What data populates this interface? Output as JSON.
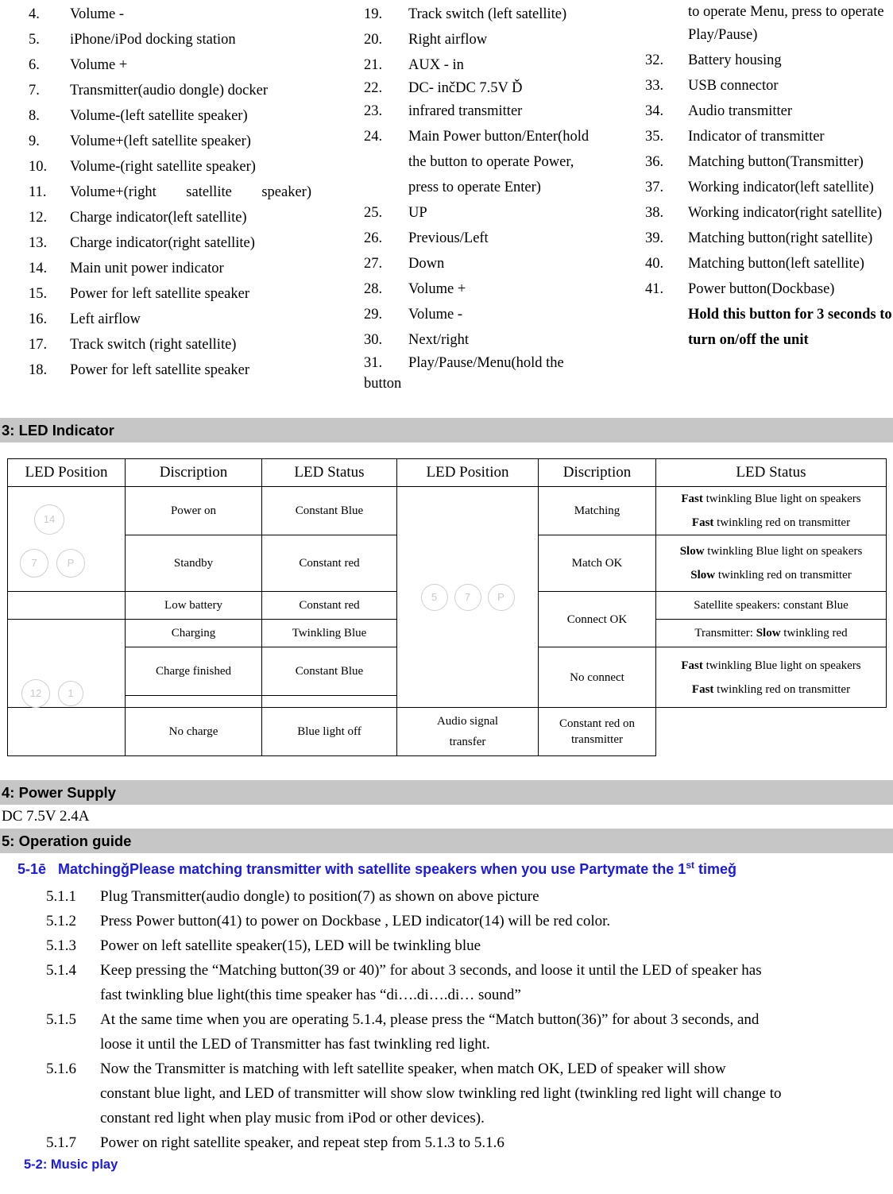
{
  "parts": {
    "left_column": [
      {
        "num": "4.",
        "label": "Volume -"
      },
      {
        "num": "5.",
        "label": "iPhone/iPod docking station"
      },
      {
        "num": "6.",
        "label": "Volume +"
      },
      {
        "num": "7.",
        "label": "Transmitter(audio dongle) docker"
      },
      {
        "num": "8.",
        "label": "Volume-(left satellite speaker)"
      },
      {
        "num": "9.",
        "label": "Volume+(left satellite speaker)"
      },
      {
        "num": "10.",
        "label": "Volume-(right satellite speaker)"
      },
      {
        "num": "11.",
        "label": "Volume+(right satellite speaker)"
      },
      {
        "num": "12.",
        "label": "Charge indicator(left satellite)"
      },
      {
        "num": "13.",
        "label": "Charge indicator(right satellite)"
      },
      {
        "num": "14.",
        "label": "Main unit power indicator"
      },
      {
        "num": "15.",
        "label": "Power for left satellite speaker"
      },
      {
        "num": "16.",
        "label": "Left airflow"
      },
      {
        "num": "17.",
        "label": "Track switch (right satellite)"
      },
      {
        "num": "18.",
        "label": "Power for left satellite speaker"
      }
    ],
    "mid_column": [
      {
        "num": "19.",
        "label": "Track switch (left satellite)"
      },
      {
        "num": "20.",
        "label": "Right airflow"
      },
      {
        "num": "21.",
        "label": "AUX - in"
      },
      {
        "num": "22.",
        "label": "DC- inčDC 7.5V   Ď"
      },
      {
        "num": "23.",
        "label": "infrared transmitter"
      }
    ],
    "mid_item_24": {
      "num": "24.",
      "line1": "Main  Power  button/Enter(hold",
      "line2": "the  button    to    operate    Power,",
      "line3": "press    to operate Enter)"
    },
    "mid_column_2": [
      {
        "num": "25.",
        "label": "UP"
      },
      {
        "num": "26.",
        "label": "Previous/Left"
      },
      {
        "num": "27.",
        "label": "Down"
      },
      {
        "num": "28.",
        "label": "Volume +"
      },
      {
        "num": "29.",
        "label": "Volume -"
      },
      {
        "num": "30.",
        "label": "Next/right"
      }
    ],
    "mid_item_31": {
      "num": "31.",
      "line1": "Play/Pause/Menu(hold     the",
      "line2": "button"
    },
    "right_continuation": {
      "line1": "to   operate   Menu,   press   to   operate",
      "line2": "Play/Pause)"
    },
    "right_column": [
      {
        "num": "32.",
        "label": "Battery housing"
      },
      {
        "num": "33.",
        "label": "USB connector"
      },
      {
        "num": "34.",
        "label": "Audio transmitter"
      },
      {
        "num": "35.",
        "label": "Indicator of transmitter"
      },
      {
        "num": "36.",
        "label": "Matching button(Transmitter)"
      },
      {
        "num": "37.",
        "label": "Working indicator(left satellite)"
      },
      {
        "num": "38.",
        "label": "Working indicator(right satellite)"
      },
      {
        "num": "39.",
        "label": "Matching button(right satellite)"
      },
      {
        "num": "40.",
        "label": "Matching button(left satellite)"
      },
      {
        "num": "41.",
        "label": "Power button(Dockbase)"
      }
    ],
    "right_note": {
      "line1": "Hold this button for 3 seconds to",
      "line2": "turn on/off the unit"
    }
  },
  "section3": {
    "heading": "3: LED Indicator",
    "headers": [
      "LED Position",
      "Discription",
      "LED Status",
      "LED Position",
      "Discription",
      "LED Status"
    ],
    "left_positions_top": [
      "14",
      "7",
      "P"
    ],
    "left_positions_bottom": [
      "12",
      "1"
    ],
    "right_positions": [
      "5",
      "7",
      "P"
    ],
    "left_rows": [
      {
        "desc": "Power on",
        "status": "Constant Blue"
      },
      {
        "desc": "Standby",
        "status": "Constant red"
      },
      {
        "desc": "Low battery",
        "status": "Constant red"
      },
      {
        "desc": "Charging",
        "status": "Twinkling Blue"
      },
      {
        "desc": "Charge finished",
        "status": "Constant Blue"
      },
      {
        "desc": "No charge",
        "status": "Blue light off"
      }
    ],
    "right_rows": [
      {
        "desc": "Matching",
        "status_lines": [
          {
            "bold": "Fast",
            "rest": " twinkling Blue light on speakers"
          },
          {
            "bold": "Fast",
            "rest": " twinkling red on transmitter"
          }
        ]
      },
      {
        "desc": "Match OK",
        "status_lines": [
          {
            "bold": "Slow",
            "rest": " twinkling Blue light on speakers"
          },
          {
            "bold": "Slow",
            "rest": " twinkling red on transmitter"
          }
        ]
      },
      {
        "desc": "Connect OK",
        "split": true,
        "status_a": "Satellite speakers: constant Blue",
        "status_b_pre": "Transmitter: ",
        "status_b_bold": "Slow",
        "status_b_post": " twinkling red"
      },
      {
        "desc": "No connect",
        "status_lines": [
          {
            "bold": "Fast",
            "rest": " twinkling Blue light on speakers"
          },
          {
            "bold": "Fast",
            "rest": " twinkling red on transmitter"
          }
        ]
      },
      {
        "desc_line1": "Audio signal",
        "desc_line2": "transfer",
        "status_plain": "Constant red on transmitter"
      }
    ]
  },
  "section4": {
    "heading": "4: Power Supply",
    "body": "DC 7.5V 2.4A"
  },
  "section5": {
    "heading": "5: Operation guide",
    "subheading_pre": "5-1ē",
    "subheading_main": "Matchingǧ",
    "subheading_rest": "Please matching transmitter with satellite speakers when you use Partymate the 1",
    "subheading_sup": "st",
    "subheading_tail": " timeǧ",
    "steps": [
      {
        "num": "5.1.1",
        "lines": [
          "Plug Transmitter(audio dongle) to position(7) as shown on above picture"
        ]
      },
      {
        "num": "5.1.2",
        "lines": [
          "Press Power button(41) to power on Dockbase , LED indicator(14) will be red color."
        ]
      },
      {
        "num": "5.1.3",
        "lines": [
          "Power on left satellite speaker(15), LED will be twinkling blue"
        ]
      },
      {
        "num": "5.1.4",
        "multi": true,
        "lines": [
          "Keep pressing the “Matching button(39 or 40)” for about 3 seconds, and loose it until the LED of speaker has",
          "fast twinkling blue light(this time speaker has “di….di….di… sound”"
        ]
      },
      {
        "num": "5.1.5",
        "multi": true,
        "lines": [
          "At the same time when you are operating 5.1.4, please press the “Match button(36)” for about 3 seconds, and",
          "loose it until the LED of Transmitter has fast twinkling red light."
        ]
      },
      {
        "num": "5.1.6",
        "multi": true,
        "lines": [
          "Now the Transmitter is matching with left satellite speaker, when match OK, LED of speaker will show",
          "constant blue light, and LED of transmitter will show slow twinkling red light (twinkling red light will change to",
          "constant red light when play music from iPod or other devices)."
        ]
      },
      {
        "num": "5.1.7",
        "lines": [
          "Power on right satellite speaker, and repeat step from 5.1.3 to 5.1.6"
        ]
      }
    ],
    "footer": "5-2: Music play"
  }
}
